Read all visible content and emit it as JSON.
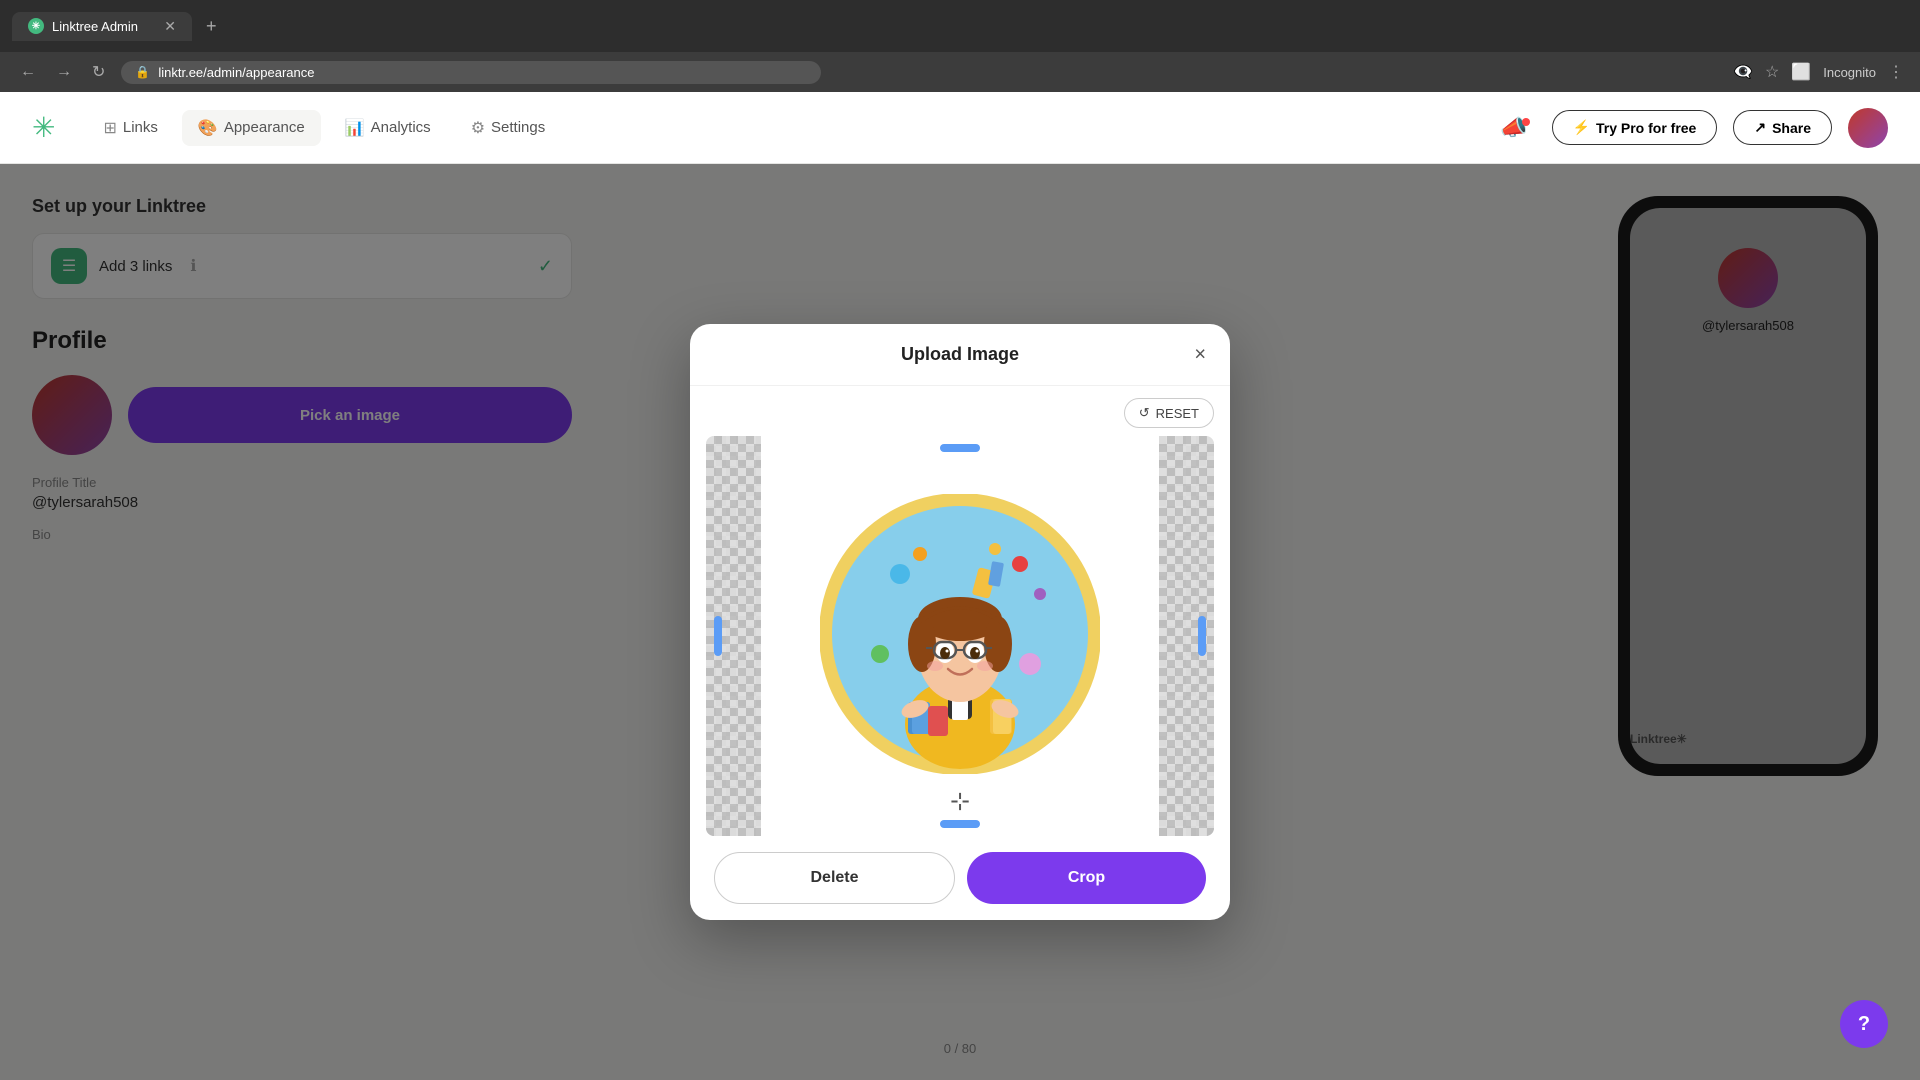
{
  "browser": {
    "tab_title": "Linktree Admin",
    "url": "linktr.ee/admin/appearance",
    "add_tab_label": "+",
    "incognito_label": "Incognito"
  },
  "header": {
    "logo_icon": "asterisk",
    "nav_items": [
      {
        "id": "links",
        "label": "Links",
        "icon": "grid"
      },
      {
        "id": "appearance",
        "label": "Appearance",
        "icon": "palette"
      },
      {
        "id": "analytics",
        "label": "Analytics",
        "icon": "bar-chart"
      },
      {
        "id": "settings",
        "label": "Settings",
        "icon": "gear"
      }
    ],
    "try_pro_label": "Try Pro for free",
    "share_label": "Share",
    "notification_dot": true
  },
  "page": {
    "setup_title": "Set up your Linktree",
    "setup_items": [
      {
        "id": "add-links",
        "label": "Add 3 links",
        "completed": true
      }
    ],
    "profile_section_title": "Profile",
    "profile_title_label": "Profile Title",
    "profile_title_value": "@tylersarah508",
    "bio_label": "Bio",
    "pick_image_button": "Pick an image",
    "char_count": "0 / 80"
  },
  "phone_preview": {
    "username": "@tylersarah508",
    "footer": "Linktree✳"
  },
  "modal": {
    "title": "Upload Image",
    "close_icon": "×",
    "reset_button": "RESET",
    "reset_icon": "↺",
    "delete_button": "Delete",
    "crop_button": "Crop"
  },
  "help_button": "?"
}
